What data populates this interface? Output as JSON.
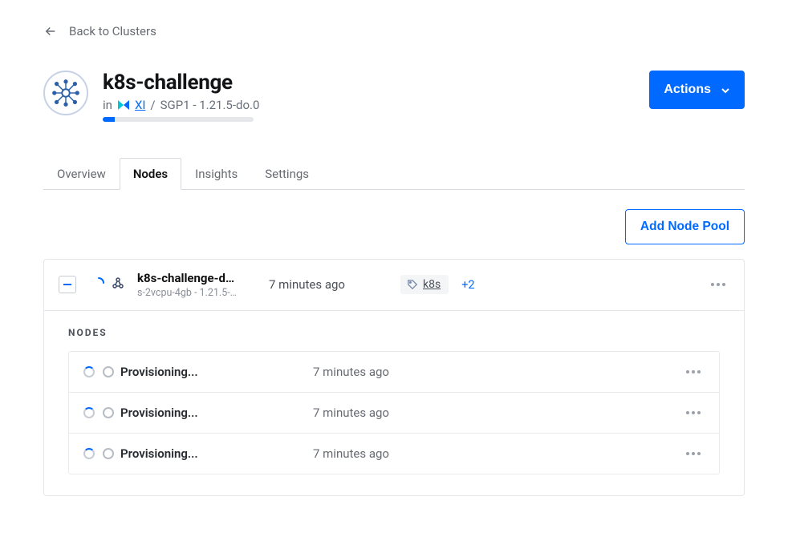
{
  "back_link": "Back to Clusters",
  "cluster": {
    "name": "k8s-challenge",
    "in_prefix": "in",
    "project": "XI",
    "sep": " / ",
    "region_version": "SGP1 - 1.21.5-do.0"
  },
  "actions_label": "Actions",
  "tabs": [
    {
      "id": "overview",
      "label": "Overview"
    },
    {
      "id": "nodes",
      "label": "Nodes"
    },
    {
      "id": "insights",
      "label": "Insights"
    },
    {
      "id": "settings",
      "label": "Settings"
    }
  ],
  "active_tab": "nodes",
  "add_pool_label": "Add Node Pool",
  "pool": {
    "name": "k8s-challenge-d…",
    "sub": "s-2vcpu-4gb - 1.21.5-…",
    "time": "7 minutes ago",
    "tag": "k8s",
    "more_tags": "+2"
  },
  "nodes_heading": "NODES",
  "nodes": [
    {
      "name": "Provisioning...",
      "time": "7 minutes ago"
    },
    {
      "name": "Provisioning...",
      "time": "7 minutes ago"
    },
    {
      "name": "Provisioning...",
      "time": "7 minutes ago"
    }
  ]
}
